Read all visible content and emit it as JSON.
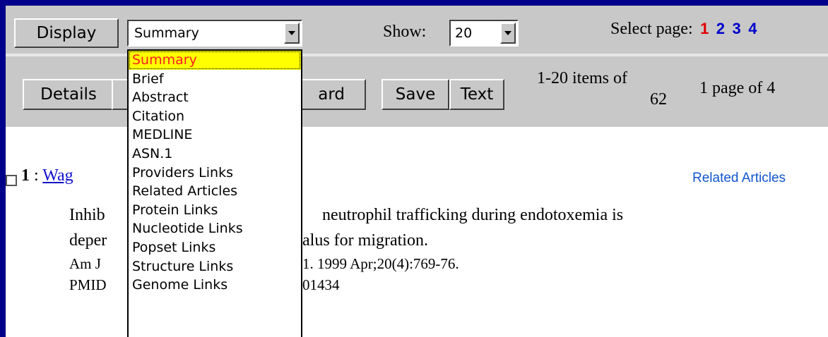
{
  "toolbar": {
    "display_button": "Display",
    "format_select": {
      "value": "Summary"
    },
    "show_label": "Show:",
    "show_select": {
      "value": "20"
    },
    "select_page_label": "Select page:",
    "pages": [
      "1",
      "2",
      "3",
      "4"
    ],
    "current_page": "1",
    "details_button": "Details",
    "clipboard_button_fragment": "ard",
    "save_button": "Save",
    "text_button": "Text",
    "items_count_line1": "1-20 items of",
    "items_count_line2": "62",
    "page_of": "1 page of 4"
  },
  "dropdown": {
    "options": [
      "Summary",
      "Brief",
      "Abstract",
      "Citation",
      "MEDLINE",
      "ASN.1",
      "Providers Links",
      "Related Articles",
      "Protein Links",
      "Nucleotide Links",
      "Popset Links",
      "Structure Links",
      "Genome Links"
    ],
    "selected_index": 0
  },
  "results": {
    "item": {
      "number": "1",
      "separator": ":",
      "author_link_visible": "Wag",
      "related_articles": "Related Articles",
      "line1_left": "Inhib",
      "line1_right": "neutrophil trafficking during endotoxemia is",
      "line2_left": "deper",
      "line2_right": "alus for migration.",
      "line3_left": "Am J",
      "line3_right": "1. 1999 Apr;20(4):769-76.",
      "line4_left": "PMID",
      "line4_right": "01434"
    }
  },
  "colors": {
    "frame": "#00008b",
    "toolbar": "#c8c8c8",
    "current_page": "#e00000",
    "other_pages": "#0000cc",
    "dropdown_highlight": "#ffff00",
    "dropdown_highlight_text": "#ff2020",
    "link": "#1111cc"
  },
  "icons": {
    "select_arrow": "chevron-down-icon",
    "checkbox": "checkbox-icon"
  }
}
